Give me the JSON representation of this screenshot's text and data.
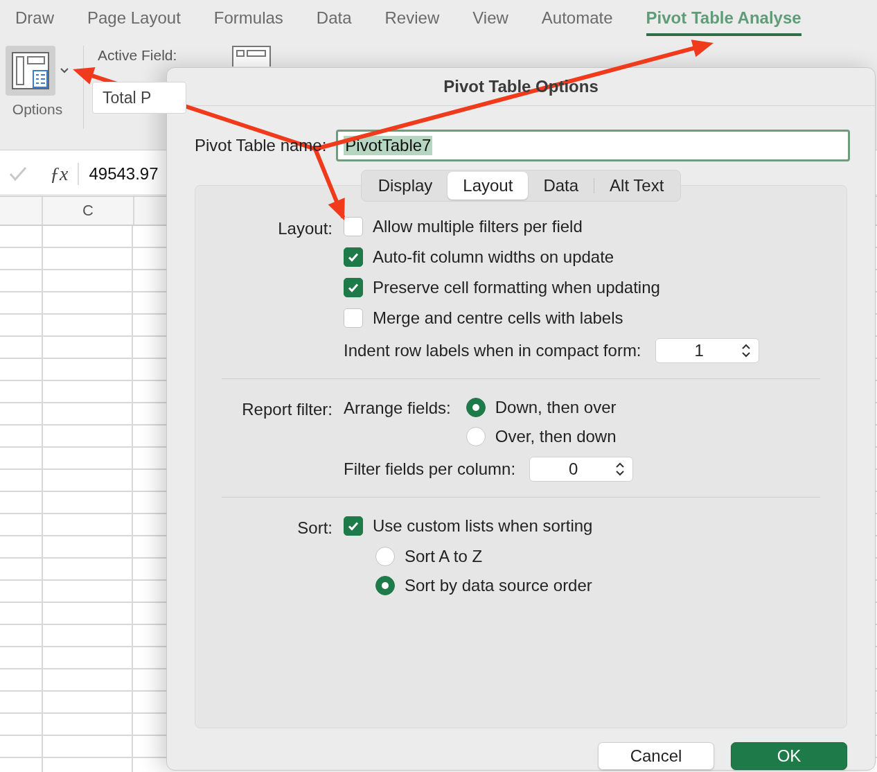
{
  "ribbon_tabs": [
    {
      "label": "Draw",
      "selected": false
    },
    {
      "label": "Page Layout",
      "selected": false
    },
    {
      "label": "Formulas",
      "selected": false
    },
    {
      "label": "Data",
      "selected": false
    },
    {
      "label": "Review",
      "selected": false
    },
    {
      "label": "View",
      "selected": false
    },
    {
      "label": "Automate",
      "selected": false
    },
    {
      "label": "Pivot Table Analyse",
      "selected": true
    }
  ],
  "ribbon": {
    "options_label": "Options",
    "active_field_label": "Active Field:",
    "active_field_value": "Total P"
  },
  "formula_bar": {
    "function_symbol": "ƒx",
    "value": "49543.97"
  },
  "columns": [
    "C"
  ],
  "dialog": {
    "title": "Pivot Table Options",
    "name_label": "Pivot Table name:",
    "name_value": "PivotTable7",
    "tabs": [
      {
        "label": "Display",
        "selected": false
      },
      {
        "label": "Layout",
        "selected": true
      },
      {
        "label": "Data",
        "selected": false
      },
      {
        "label": "Alt Text",
        "selected": false
      }
    ],
    "sections": [
      {
        "label": "Layout:",
        "items": [
          {
            "kind": "checkbox",
            "label": "Allow multiple filters per field",
            "checked": false
          },
          {
            "kind": "checkbox",
            "label": "Auto-fit column widths on update",
            "checked": true
          },
          {
            "kind": "checkbox",
            "label": "Preserve cell formatting when updating",
            "checked": true
          },
          {
            "kind": "checkbox",
            "label": "Merge and centre cells with labels",
            "checked": false
          },
          {
            "kind": "stepper",
            "label": "Indent row labels when in compact form:",
            "value": "1"
          }
        ]
      },
      {
        "label": "Report filter:",
        "items": [
          {
            "kind": "radio_group",
            "label": "Arrange fields:",
            "options": [
              {
                "label": "Down, then over",
                "selected": true
              },
              {
                "label": "Over, then down",
                "selected": false
              }
            ]
          },
          {
            "kind": "stepper",
            "label": "Filter fields per column:",
            "value": "0"
          }
        ]
      },
      {
        "label": "Sort:",
        "items": [
          {
            "kind": "checkbox",
            "label": "Use custom lists when sorting",
            "checked": true
          },
          {
            "kind": "radio_group",
            "options": [
              {
                "label": "Sort A to Z",
                "selected": false
              },
              {
                "label": "Sort by data source order",
                "selected": true
              }
            ]
          }
        ]
      }
    ],
    "buttons": [
      {
        "label": "Cancel",
        "kind": "secondary"
      },
      {
        "label": "OK",
        "kind": "primary"
      }
    ]
  }
}
